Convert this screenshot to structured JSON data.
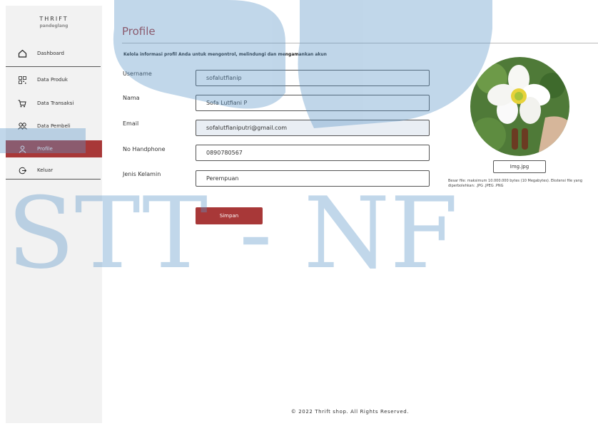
{
  "brand": {
    "title": "THRIFT",
    "subtitle": "pandeglang"
  },
  "sidebar": {
    "items": [
      {
        "label": "Dashboard",
        "icon": "home-icon"
      },
      {
        "label": "Data Produk",
        "icon": "barcode-icon"
      },
      {
        "label": "Data Transaksi",
        "icon": "cart-icon"
      },
      {
        "label": "Data Pembeli",
        "icon": "users-icon"
      },
      {
        "label": "Profile",
        "icon": "user-icon",
        "active": true
      },
      {
        "label": "Keluar",
        "icon": "logout-icon"
      }
    ]
  },
  "page": {
    "title": "Profile",
    "subtitle": "Kelola informasi profil Anda untuk mengontrol, melindungi dan mengamankan akun"
  },
  "form": {
    "username_label": "Username",
    "username_value": "sofalutfianip",
    "nama_label": "Nama",
    "nama_value": "Sofa Lutfiani P",
    "email_label": "Email",
    "email_value": "sofalutfianiputri@gmail.com",
    "hp_label": "No Handphone",
    "hp_value": "0890780567",
    "gender_label": "Jenis Kelamin",
    "gender_value": "Perempuan",
    "save_label": "Simpan"
  },
  "photo": {
    "file_label": "Img.jpg",
    "note": "Besar file: maksimum 10.000.000 bytes (10 Megabytes). Ekstensi file yang diperbolehkan: .JPG .JPEG .PNG"
  },
  "footer": {
    "text": "© 2022 Thrift shop. All Rights Reserved."
  },
  "watermark": {
    "text": "STT - NF",
    "color": "#5b95c7"
  },
  "colors": {
    "accent": "#a83838",
    "sidebar_bg": "#f2f2f2",
    "watermark": "#5b95c7"
  }
}
